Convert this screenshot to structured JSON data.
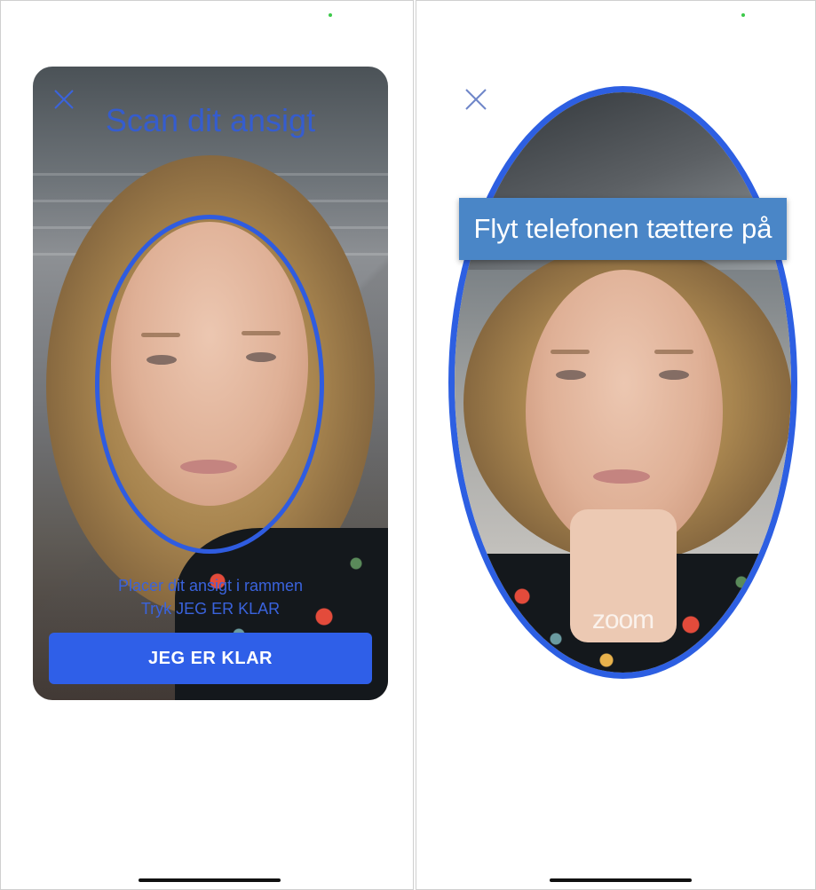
{
  "screens": {
    "left": {
      "title": "Scan dit ansigt",
      "instructions": [
        "Placer dit ansigt i rammen",
        "Tryk JEG ER KLAR"
      ],
      "ready_button": "JEG ER KLAR",
      "close_icon": "close-icon"
    },
    "right": {
      "banner": "Flyt telefonen tættere på",
      "watermark": "zoom",
      "close_icon": "close-icon"
    }
  },
  "colors": {
    "accent_blue": "#2f5fe8",
    "banner_blue": "#4a86c7",
    "status_green": "#3cc94a"
  }
}
